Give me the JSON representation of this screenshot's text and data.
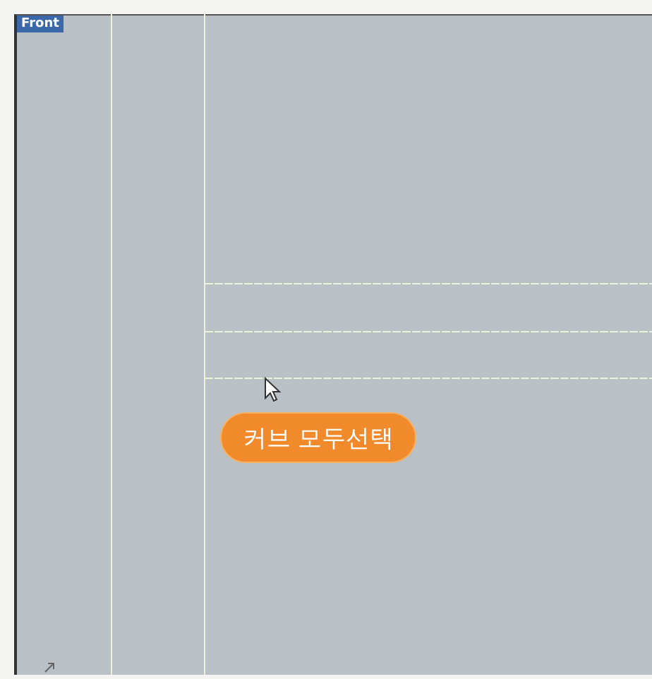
{
  "viewport": {
    "title": "Front"
  },
  "callout": {
    "text": "커브 모두선택"
  }
}
